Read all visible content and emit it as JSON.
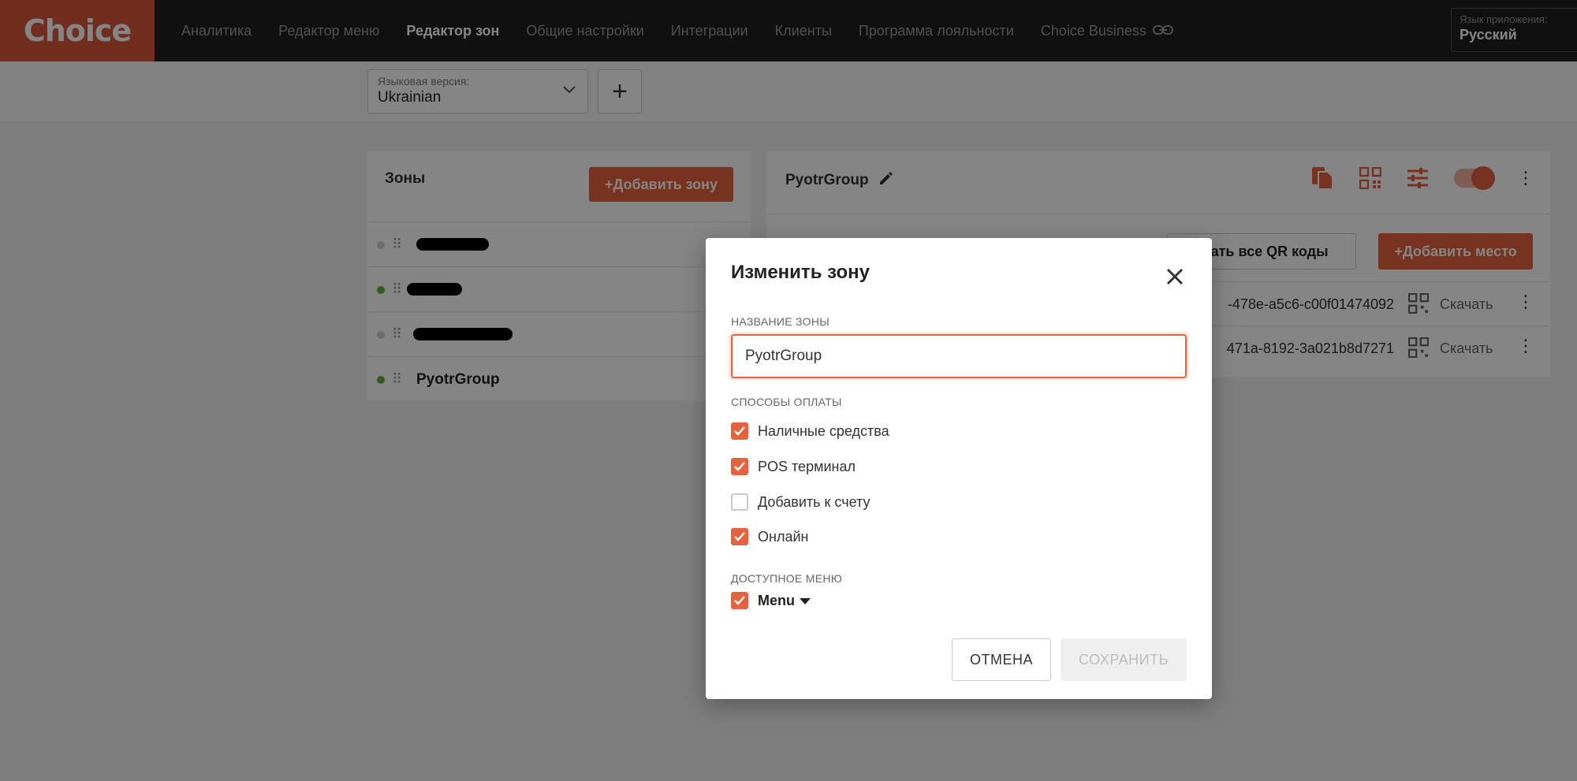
{
  "header": {
    "logo": "Choice",
    "nav": [
      {
        "label": "Аналитика"
      },
      {
        "label": "Редактор меню"
      },
      {
        "label": "Редактор зон"
      },
      {
        "label": "Общие настройки"
      },
      {
        "label": "Интеграции"
      },
      {
        "label": "Клиенты"
      },
      {
        "label": "Программа лояльности"
      },
      {
        "label": "Choice Business"
      }
    ],
    "active_nav": "Редактор зон",
    "app_language_label": "Язык приложения:",
    "app_language_value": "Русский"
  },
  "toolbar": {
    "language_version_label": "Языковая версия:",
    "language_version_value": "Ukrainian",
    "add_language_label": "+"
  },
  "zones": {
    "title": "Зоны",
    "add_button": "+Добавить зону",
    "items": [
      {
        "status": "inactive",
        "name": ""
      },
      {
        "status": "active",
        "name": ""
      },
      {
        "status": "inactive",
        "name": ""
      },
      {
        "status": "active",
        "name": "PyotrGroup"
      }
    ]
  },
  "group": {
    "title": "PyotrGroup",
    "download_all_button": "ачать все QR коды",
    "add_place_button": "+Добавить место",
    "places": [
      {
        "uuid": "-478e-a5c6-c00f01474092",
        "download": "Скачать"
      },
      {
        "uuid": "471a-8192-3a021b8d7271",
        "download": "Скачать"
      }
    ]
  },
  "modal": {
    "title": "Изменить зону",
    "zone_name_label": "НАЗВАНИЕ ЗОНЫ",
    "zone_name_value": "PyotrGroup",
    "payment_label": "СПОСОБЫ ОПЛАТЫ",
    "payments": [
      {
        "label": "Наличные средства",
        "checked": true
      },
      {
        "label": "POS терминал",
        "checked": true
      },
      {
        "label": "Добавить к счету",
        "checked": false
      },
      {
        "label": "Онлайн",
        "checked": true
      }
    ],
    "menu_label": "ДОСТУПНОЕ МЕНЮ",
    "menu_item": {
      "label": "Menu",
      "checked": true
    },
    "cancel_button": "ОТМЕНА",
    "save_button": "СОХРАНИТЬ"
  },
  "colors": {
    "accent": "#e4633f",
    "nav_bg": "#1f1f1f",
    "active_dot": "#5db13a",
    "inactive_dot": "#cfcfcf"
  }
}
